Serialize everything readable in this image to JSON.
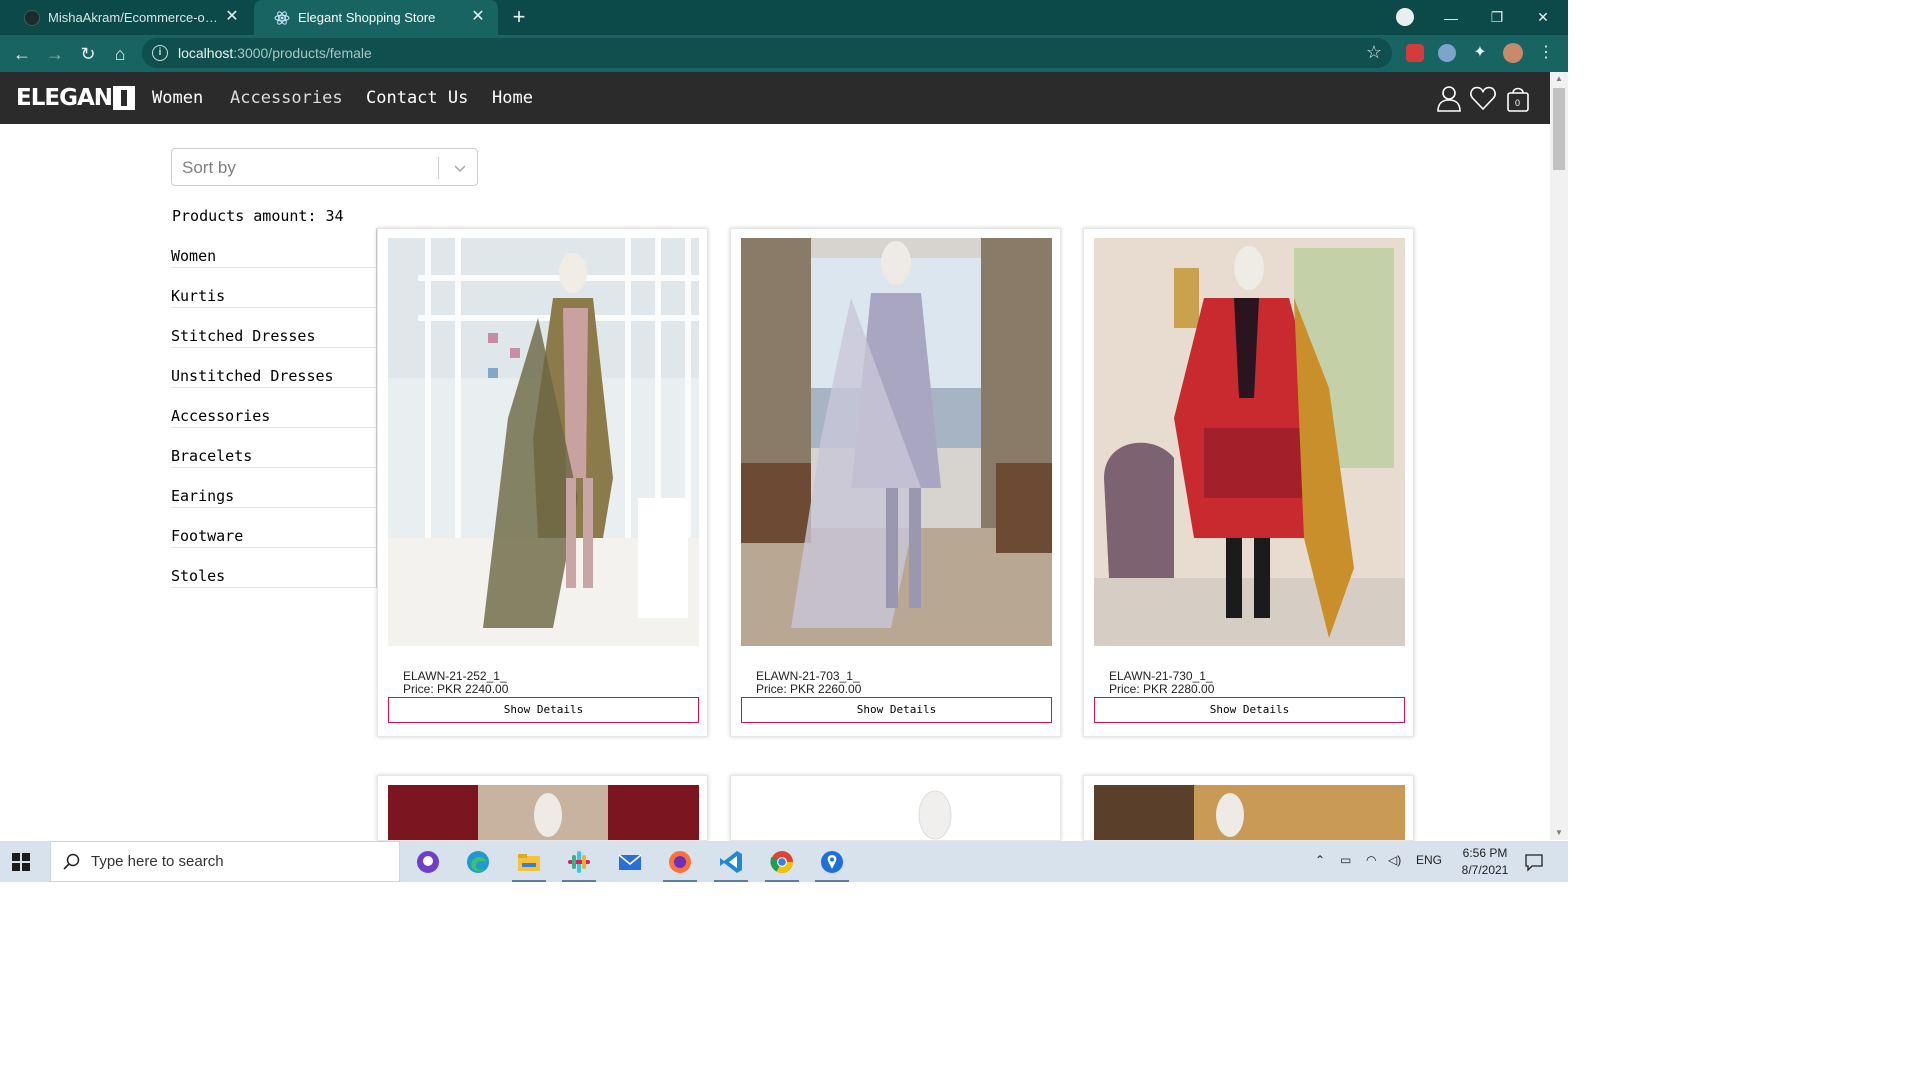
{
  "browser": {
    "tabs": [
      {
        "title": "MishaAkram/Ecommerce-online",
        "active": false
      },
      {
        "title": "Elegant Shopping Store",
        "active": true
      }
    ],
    "url_host": "localhost",
    "url_rest": ":3000/products/female"
  },
  "site": {
    "logo_text": "ELEGAN",
    "nav": [
      "Women",
      "Accessories",
      "Contact Us",
      "Home"
    ],
    "cart_count": "0"
  },
  "sort": {
    "placeholder": "Sort by"
  },
  "amount": {
    "label": "Products amount:",
    "value": "34"
  },
  "categories": [
    "Women",
    "Kurtis",
    "Stitched Dresses",
    "Unstitched Dresses",
    "Accessories",
    "Bracelets",
    "Earings",
    "Footware",
    "Stoles"
  ],
  "products": [
    {
      "name": "ELAWN-21-252_1_",
      "price": "Price: PKR 2240.00",
      "button": "Show Details"
    },
    {
      "name": "ELAWN-21-703_1_",
      "price": "Price: PKR 2260.00",
      "button": "Show Details"
    },
    {
      "name": "ELAWN-21-730_1_",
      "price": "Price: PKR 2280.00",
      "button": "Show Details"
    }
  ],
  "taskbar": {
    "search_placeholder": "Type here to search",
    "lang": "ENG",
    "time": "6:56 PM",
    "date": "8/7/2021"
  },
  "colors": {
    "tabbar": "#0b4a49",
    "toolbar": "#176463",
    "site_nav": "#2b2b2b",
    "button_border": "#c2185b"
  }
}
